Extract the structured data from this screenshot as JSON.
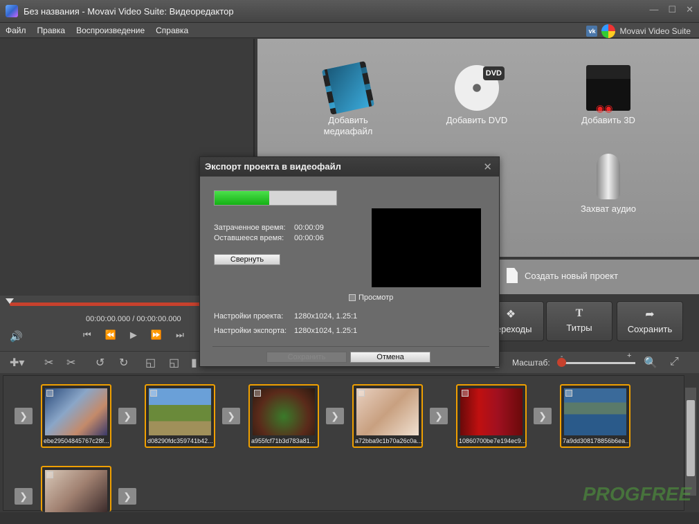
{
  "window": {
    "title": "Без названия - Movavi Video Suite: Видеоредактор"
  },
  "menu": [
    "Файл",
    "Правка",
    "Воспроизведение",
    "Справка"
  ],
  "brand": {
    "name": "Movavi Video Suite",
    "vk": "vk"
  },
  "player": {
    "timecode": "00:00:00.000  /  00:00:00.000"
  },
  "media_panel": {
    "tiles": [
      {
        "label": "Добавить медиафайл"
      },
      {
        "label": "Добавить DVD",
        "badge": "DVD"
      },
      {
        "label": "Добавить 3D"
      },
      {
        "label": "Захват аудио"
      }
    ],
    "new_project": "Создать новый проект"
  },
  "buttons": {
    "transitions": "Переходы",
    "titles": "Титры",
    "save": "Сохранить"
  },
  "toolbar": {
    "zoom_label": "Масштаб:",
    "zoom_minus": "-",
    "zoom_plus": "+"
  },
  "clips": [
    {
      "name": "ebe29504845767c28f..."
    },
    {
      "name": "d08290fdc359741b42..."
    },
    {
      "name": "a955fcf71b3d783a81..."
    },
    {
      "name": "a72bba9c1b70a26c0a..."
    },
    {
      "name": "10860700be7e194ec9..."
    },
    {
      "name": "7a9dd308178856b6ea..."
    },
    {
      "name": ""
    }
  ],
  "watermark": "PROGFREE",
  "dialog": {
    "title": "Экспорт проекта в видеофайл",
    "progress": 0.45,
    "elapsed_label": "Затраченное время:",
    "elapsed_value": "00:00:09",
    "remaining_label": "Оставшееся время:",
    "remaining_value": "00:00:06",
    "minimize_button": "Свернуть",
    "preview_checkbox": "Просмотр",
    "project_settings_label": "Настройки проекта:",
    "project_settings_value": "1280x1024, 1.25:1",
    "export_settings_label": "Настройки экспорта:",
    "export_settings_value": "1280x1024, 1.25:1",
    "save_button": "Сохранить",
    "cancel_button": "Отмена"
  }
}
